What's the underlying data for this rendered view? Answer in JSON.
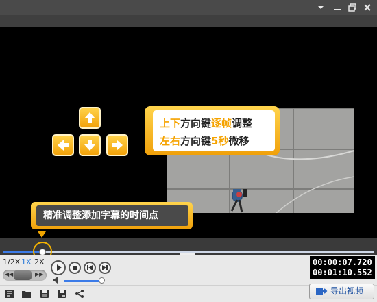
{
  "window": {
    "controls": [
      "chevron-down-icon",
      "minimize-icon",
      "restore-icon",
      "close-icon"
    ]
  },
  "hint": {
    "line1_a": "上下",
    "line1_b": "方向键",
    "line1_c": "逐帧",
    "line1_d": "调整",
    "line2_a": "左右",
    "line2_b": "方向键",
    "line2_c": "5秒",
    "line2_d": "微移",
    "highlight_color": "#f5a300"
  },
  "tip": {
    "text": "精准调整添加字幕的时间点"
  },
  "playback": {
    "speed_half": "1/2X",
    "speed_1x": "1X",
    "speed_2x": "2X",
    "progress": 0.11,
    "volume": 0.95
  },
  "time": {
    "current": "00:00:07.720",
    "total": "00:01:10.552"
  },
  "toolbar": {
    "icons": [
      "new-subtitle-icon",
      "open-folder-icon",
      "save-icon",
      "save-as-icon",
      "share-icon"
    ]
  },
  "export": {
    "label": "导出视频"
  },
  "colors": {
    "accent_orange": "#f5a300",
    "accent_blue": "#3b7be8"
  }
}
